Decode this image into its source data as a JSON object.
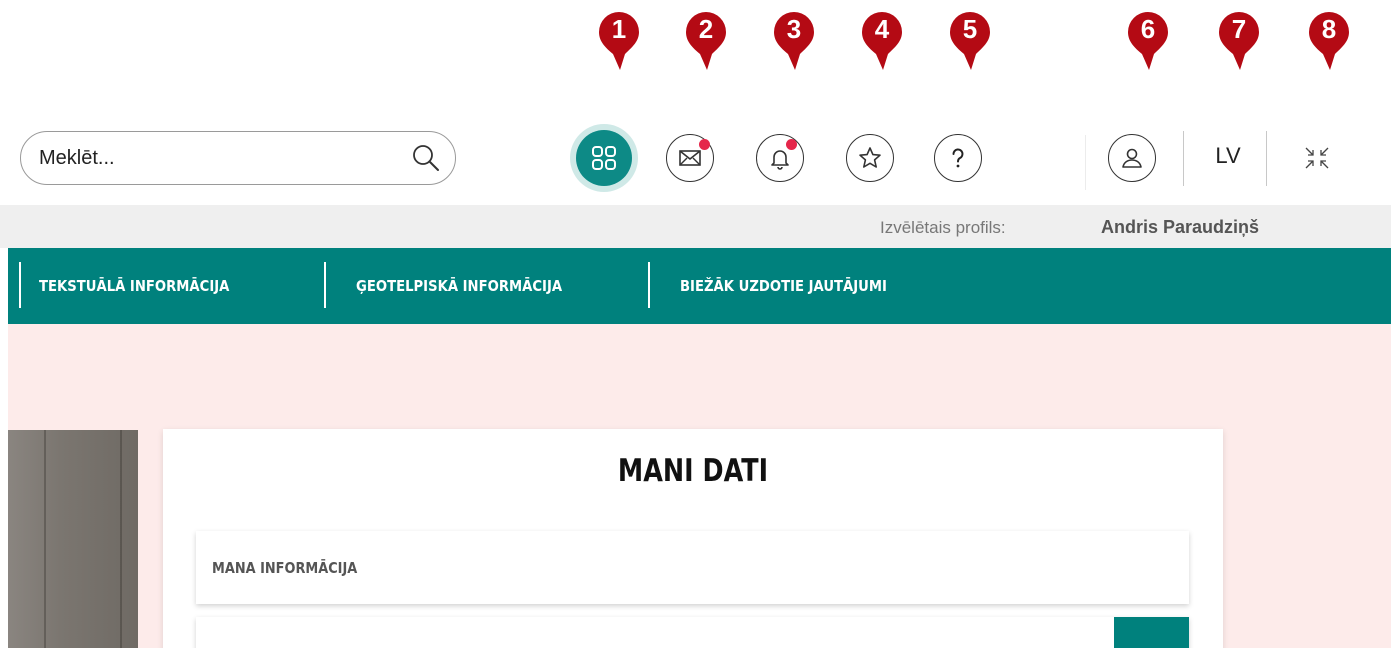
{
  "search": {
    "placeholder": "Meklēt..."
  },
  "toolbar": {
    "apps_icon": "apps-grid-icon",
    "messages_icon": "envelope-icon",
    "notifications_icon": "bell-icon",
    "favorites_icon": "star-icon",
    "help_icon": "question-icon",
    "profile_icon": "user-icon",
    "language": "LV",
    "collapse_icon": "collapse-icon",
    "badge_color": "#e5264a",
    "accent_color": "#0d8a86"
  },
  "markers": [
    "1",
    "2",
    "3",
    "4",
    "5",
    "6",
    "7",
    "8"
  ],
  "marker_color": "#b40a14",
  "profile": {
    "label": "Izvēlētais profils:",
    "name": "Andris Paraudziņš"
  },
  "nav": {
    "items": [
      {
        "label": "TEKSTUĀLĀ INFORMĀCIJA"
      },
      {
        "label": "ĢEOTELPISKĀ INFORMĀCIJA"
      },
      {
        "label": "BIEŽĀK UZDOTIE JAUTĀJUMI"
      }
    ],
    "color": "#00817d"
  },
  "main": {
    "title": "MANI DATI",
    "sections": [
      {
        "title": "MANA INFORMĀCIJA"
      }
    ],
    "background": "#fdebea"
  }
}
